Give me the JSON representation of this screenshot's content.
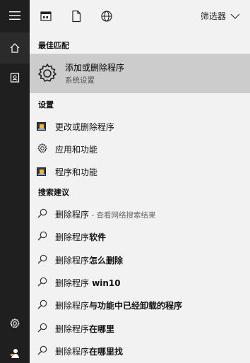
{
  "toolbar": {
    "filter_label": "筛选器",
    "icons": [
      "apps-icon",
      "document-icon",
      "globe-icon",
      "chevron-down-icon"
    ]
  },
  "rail": {
    "icons": [
      "hamburger-menu-icon",
      "home-icon",
      "contact-card-icon",
      "settings-gear-icon",
      "user-icon"
    ]
  },
  "best_match": {
    "heading": "最佳匹配",
    "title": "添加或删除程序",
    "subtitle": "系统设置"
  },
  "settings": {
    "heading": "设置",
    "items": [
      {
        "label": "更改或删除程序",
        "icon": "control-panel-icon"
      },
      {
        "label": "应用和功能",
        "icon": "gear-icon"
      },
      {
        "label": "程序和功能",
        "icon": "control-panel-icon"
      }
    ]
  },
  "suggestions": {
    "heading": "搜索建议",
    "items": [
      {
        "prefix": "删除程序",
        "bold": "",
        "extra": " - 查看网络搜索结果"
      },
      {
        "prefix": "删除程序",
        "bold": "软件",
        "extra": ""
      },
      {
        "prefix": "删除程序",
        "bold": "怎么删除",
        "extra": ""
      },
      {
        "prefix": "删除程序",
        "bold": " win10",
        "extra": ""
      },
      {
        "prefix": "删除程序",
        "bold": "与功能中已经卸载的程序",
        "extra": ""
      },
      {
        "prefix": "删除程序",
        "bold": "在哪里",
        "extra": ""
      },
      {
        "prefix": "删除程序",
        "bold": "在哪里找",
        "extra": ""
      }
    ]
  },
  "colors": {
    "rail": "#1f1f1f",
    "panel": "#f2f2f2",
    "highlight": "#cccccc"
  }
}
